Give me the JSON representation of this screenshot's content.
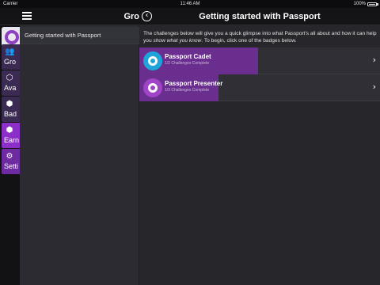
{
  "status_bar": {
    "carrier": "Carrier",
    "wifi_icon": "wifi-icon",
    "time": "11:46 AM",
    "battery": "100%"
  },
  "header": {
    "menu_icon": "hamburger-menu-icon",
    "group_title": "Gro",
    "back_icon": "chevron-left-circle-icon",
    "page_title": "Getting started with Passport"
  },
  "rail": {
    "items": [
      {
        "label": "Gro",
        "icon": "people-icon"
      },
      {
        "label": "Ava",
        "icon": "hexagon-icon"
      },
      {
        "label": "Bad",
        "icon": "badge-icon"
      },
      {
        "label": "Earn",
        "icon": "hexagon-badge-icon"
      },
      {
        "label": "Setti",
        "icon": "gears-icon"
      }
    ]
  },
  "list": {
    "items": [
      {
        "label": "Getting started with Passport"
      }
    ]
  },
  "content": {
    "intro_before": "The challenges below will give you a quick glimpse into what Passport's all about and how it can help you ",
    "intro_em": "show what you know",
    "intro_after": ". To begin, click one of the badges below.",
    "badges": [
      {
        "name": "Passport Cadet",
        "progress": "1/2 Challenges Complete",
        "completed": 1,
        "total": 2,
        "color": "#1ea4d8"
      },
      {
        "name": "Passport Presenter",
        "progress": "1/3 Challenges Complete",
        "completed": 1,
        "total": 3,
        "color": "#a044c7"
      }
    ]
  },
  "colors": {
    "accent": "#8c2fc9",
    "progress_fill": "#6a2e8f"
  }
}
